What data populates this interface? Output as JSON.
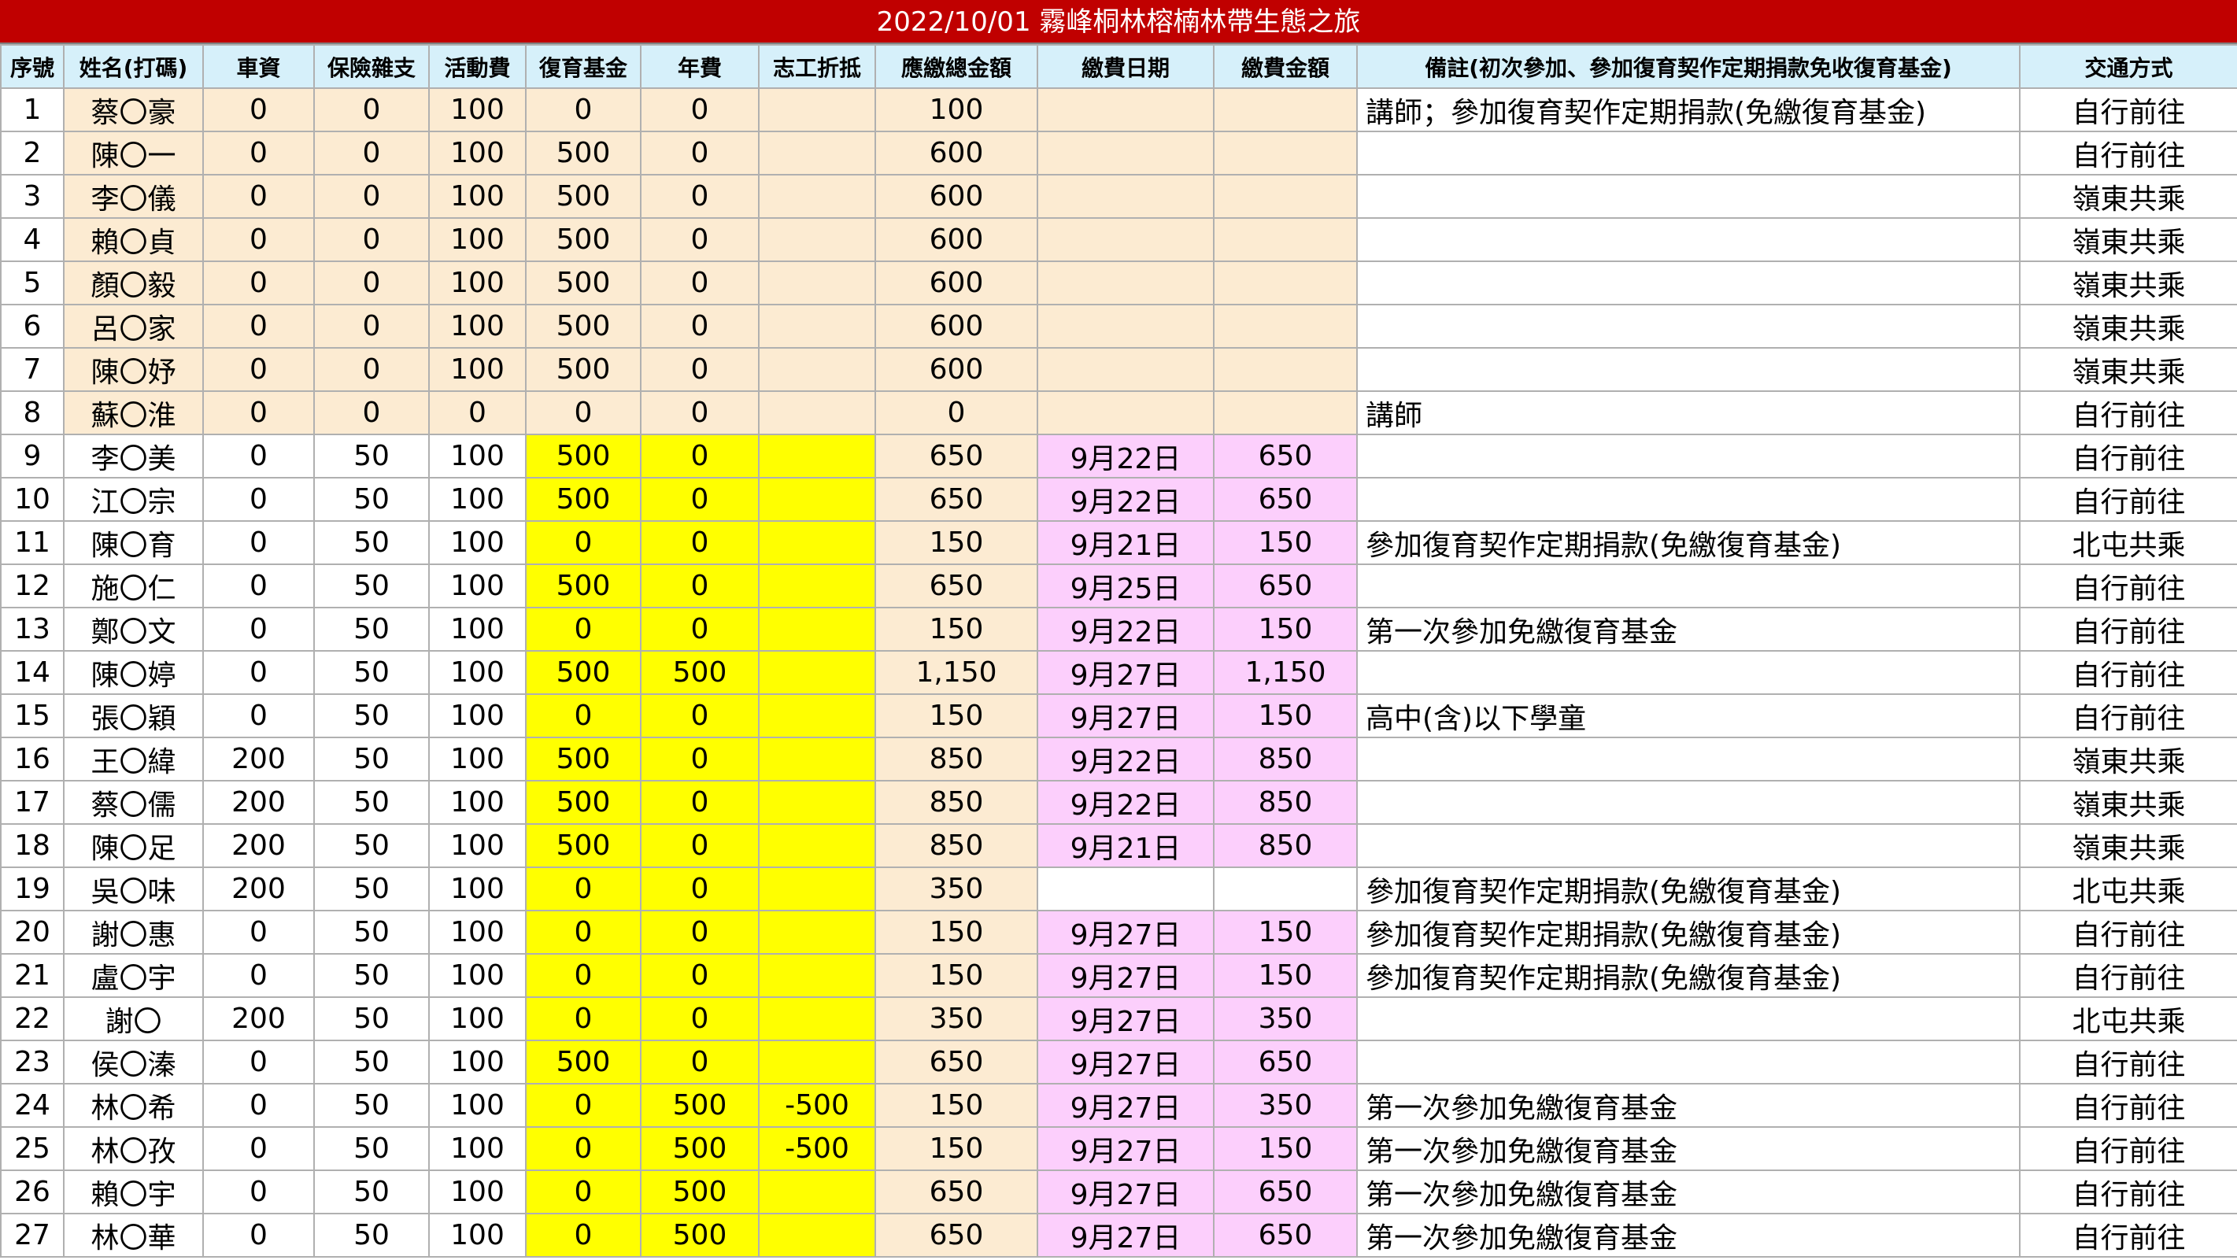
{
  "title": "2022/10/01 霧峰桐林榕楠林帶生態之旅",
  "colors": {
    "title_bg": "#c00000",
    "header_bg": "#d6f0fa",
    "tan": "#fcebd2",
    "yellow": "#ffff00",
    "pink": "#fccffc"
  },
  "headers": [
    "序號",
    "姓名(打碼)",
    "車資",
    "保險雜支",
    "活動費",
    "復育基金",
    "年費",
    "志工折抵",
    "應繳總金額",
    "繳費日期",
    "繳費金額",
    "備註(初次參加、參加復育契作定期捐款免收復育基金)",
    "交通方式"
  ],
  "rows": [
    [
      "1",
      "蔡〇豪",
      "0",
      "0",
      "100",
      "0",
      "0",
      "",
      "100",
      "",
      "",
      "講師；參加復育契作定期捐款(免繳復育基金)",
      "自行前往"
    ],
    [
      "2",
      "陳〇一",
      "0",
      "0",
      "100",
      "500",
      "0",
      "",
      "600",
      "",
      "",
      "",
      "自行前往"
    ],
    [
      "3",
      "李〇儀",
      "0",
      "0",
      "100",
      "500",
      "0",
      "",
      "600",
      "",
      "",
      "",
      "嶺東共乘"
    ],
    [
      "4",
      "賴〇貞",
      "0",
      "0",
      "100",
      "500",
      "0",
      "",
      "600",
      "",
      "",
      "",
      "嶺東共乘"
    ],
    [
      "5",
      "顏〇毅",
      "0",
      "0",
      "100",
      "500",
      "0",
      "",
      "600",
      "",
      "",
      "",
      "嶺東共乘"
    ],
    [
      "6",
      "呂〇家",
      "0",
      "0",
      "100",
      "500",
      "0",
      "",
      "600",
      "",
      "",
      "",
      "嶺東共乘"
    ],
    [
      "7",
      "陳〇妤",
      "0",
      "0",
      "100",
      "500",
      "0",
      "",
      "600",
      "",
      "",
      "",
      "嶺東共乘"
    ],
    [
      "8",
      "蘇〇淮",
      "0",
      "0",
      "0",
      "0",
      "0",
      "",
      "0",
      "",
      "",
      "講師",
      "自行前往"
    ],
    [
      "9",
      "李〇美",
      "0",
      "50",
      "100",
      "500",
      "0",
      "",
      "650",
      "9月22日",
      "650",
      "",
      "自行前往"
    ],
    [
      "10",
      "江〇宗",
      "0",
      "50",
      "100",
      "500",
      "0",
      "",
      "650",
      "9月22日",
      "650",
      "",
      "自行前往"
    ],
    [
      "11",
      "陳〇育",
      "0",
      "50",
      "100",
      "0",
      "0",
      "",
      "150",
      "9月21日",
      "150",
      "參加復育契作定期捐款(免繳復育基金)",
      "北屯共乘"
    ],
    [
      "12",
      "施〇仁",
      "0",
      "50",
      "100",
      "500",
      "0",
      "",
      "650",
      "9月25日",
      "650",
      "",
      "自行前往"
    ],
    [
      "13",
      "鄭〇文",
      "0",
      "50",
      "100",
      "0",
      "0",
      "",
      "150",
      "9月22日",
      "150",
      "第一次參加免繳復育基金",
      "自行前往"
    ],
    [
      "14",
      "陳〇婷",
      "0",
      "50",
      "100",
      "500",
      "500",
      "",
      "1,150",
      "9月27日",
      "1,150",
      "",
      "自行前往"
    ],
    [
      "15",
      "張〇穎",
      "0",
      "50",
      "100",
      "0",
      "0",
      "",
      "150",
      "9月27日",
      "150",
      "高中(含)以下學童",
      "自行前往"
    ],
    [
      "16",
      "王〇緯",
      "200",
      "50",
      "100",
      "500",
      "0",
      "",
      "850",
      "9月22日",
      "850",
      "",
      "嶺東共乘"
    ],
    [
      "17",
      "蔡〇儒",
      "200",
      "50",
      "100",
      "500",
      "0",
      "",
      "850",
      "9月22日",
      "850",
      "",
      "嶺東共乘"
    ],
    [
      "18",
      "陳〇足",
      "200",
      "50",
      "100",
      "500",
      "0",
      "",
      "850",
      "9月21日",
      "850",
      "",
      "嶺東共乘"
    ],
    [
      "19",
      "吳〇味",
      "200",
      "50",
      "100",
      "0",
      "0",
      "",
      "350",
      "",
      "",
      "參加復育契作定期捐款(免繳復育基金)",
      "北屯共乘"
    ],
    [
      "20",
      "謝〇惠",
      "0",
      "50",
      "100",
      "0",
      "0",
      "",
      "150",
      "9月27日",
      "150",
      "參加復育契作定期捐款(免繳復育基金)",
      "自行前往"
    ],
    [
      "21",
      "盧〇宇",
      "0",
      "50",
      "100",
      "0",
      "0",
      "",
      "150",
      "9月27日",
      "150",
      "參加復育契作定期捐款(免繳復育基金)",
      "自行前往"
    ],
    [
      "22",
      "謝〇",
      "200",
      "50",
      "100",
      "0",
      "0",
      "",
      "350",
      "9月27日",
      "350",
      "",
      "北屯共乘"
    ],
    [
      "23",
      "侯〇溱",
      "0",
      "50",
      "100",
      "500",
      "0",
      "",
      "650",
      "9月27日",
      "650",
      "",
      "自行前往"
    ],
    [
      "24",
      "林〇希",
      "0",
      "50",
      "100",
      "0",
      "500",
      "-500",
      "150",
      "9月27日",
      "350",
      "第一次參加免繳復育基金",
      "自行前往"
    ],
    [
      "25",
      "林〇孜",
      "0",
      "50",
      "100",
      "0",
      "500",
      "-500",
      "150",
      "9月27日",
      "150",
      "第一次參加免繳復育基金",
      "自行前往"
    ],
    [
      "26",
      "賴〇宇",
      "0",
      "50",
      "100",
      "0",
      "500",
      "",
      "650",
      "9月27日",
      "650",
      "第一次參加免繳復育基金",
      "自行前往"
    ],
    [
      "27",
      "林〇華",
      "0",
      "50",
      "100",
      "0",
      "500",
      "",
      "650",
      "9月27日",
      "650",
      "第一次參加免繳復育基金",
      "自行前往"
    ]
  ]
}
